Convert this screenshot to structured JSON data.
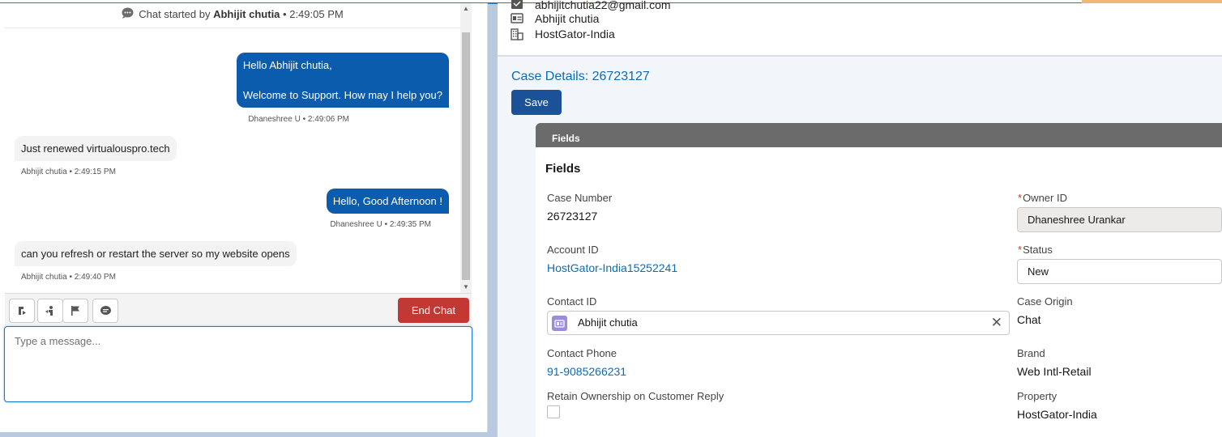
{
  "chat": {
    "header": {
      "prefix": "Chat started by",
      "name": "Abhijit chutia",
      "time": "• 2:49:05 PM"
    },
    "messages": [
      {
        "from": "agent",
        "line1": "Hello Abhijit chutia,",
        "line2": "Welcome to Support. How may I help you?",
        "meta": "Dhaneshree U • 2:49:06 PM"
      },
      {
        "from": "customer",
        "text": "Just renewed virtualouspro.tech",
        "meta": "Abhijit chutia • 2:49:15 PM"
      },
      {
        "from": "agent",
        "text": "Hello, Good Afternoon !",
        "meta": "Dhaneshree U • 2:49:35 PM"
      },
      {
        "from": "customer",
        "text": "can you refresh or restart the server so my website opens",
        "meta": "Abhijit chutia • 2:49:40 PM"
      }
    ],
    "toolbar": {
      "end_chat_label": "End Chat",
      "icons": [
        "transfer-icon",
        "raise-flag-icon",
        "flag-icon",
        "quick-text-icon"
      ]
    },
    "input_placeholder": "Type a message..."
  },
  "contact": {
    "email": "abhijitchutia22@gmail.com",
    "name": "Abhijit chutia",
    "company": "HostGator-India"
  },
  "case": {
    "title": "Case Details: 26723127",
    "save_label": "Save",
    "section_band": "Fields",
    "section_heading": "Fields",
    "case_number_label": "Case Number",
    "case_number": "26723127",
    "owner_label": "Owner ID",
    "owner_value": "Dhaneshree Urankar",
    "account_label": "Account ID",
    "account_value": "HostGator-India15252241",
    "status_label": "Status",
    "status_value": "New",
    "contact_label": "Contact ID",
    "contact_value": "Abhijit chutia",
    "origin_label": "Case Origin",
    "origin_value": "Chat",
    "phone_label": "Contact Phone",
    "phone_value": "91-9085266231",
    "brand_label": "Brand",
    "brand_value": "Web Intl-Retail",
    "retain_label": "Retain Ownership on Customer Reply",
    "property_label": "Property",
    "property_value": "HostGator-India"
  },
  "colors": {
    "agent_bubble": "#0b5cad",
    "end_chat": "#c23934",
    "save": "#1b5297",
    "link": "#0b6cb8"
  }
}
